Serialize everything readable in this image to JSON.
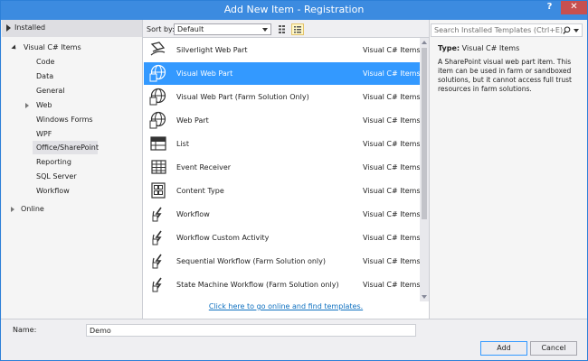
{
  "window": {
    "title": "Add New Item - Registration",
    "help_label": "?",
    "close_label": "✕"
  },
  "tree": {
    "header": "Installed",
    "root": "Visual C# Items",
    "children": [
      "Code",
      "Data",
      "General",
      "Web",
      "Windows Forms",
      "WPF",
      "Office/SharePoint",
      "Reporting",
      "SQL Server",
      "Workflow"
    ],
    "selected": "Office/SharePoint",
    "online": "Online"
  },
  "sortbar": {
    "label": "Sort by:",
    "value": "Default"
  },
  "templates": [
    {
      "name": "Silverlight Web Part",
      "category": "Visual C# Items",
      "icon": "silverlight-icon"
    },
    {
      "name": "Visual Web Part",
      "category": "Visual C# Items",
      "icon": "globe-page-icon",
      "selected": true
    },
    {
      "name": "Visual Web Part (Farm Solution Only)",
      "category": "Visual C# Items",
      "icon": "globe-page-icon"
    },
    {
      "name": "Web Part",
      "category": "Visual C# Items",
      "icon": "globe-page-icon"
    },
    {
      "name": "List",
      "category": "Visual C# Items",
      "icon": "list-icon"
    },
    {
      "name": "Event Receiver",
      "category": "Visual C# Items",
      "icon": "event-receiver-icon"
    },
    {
      "name": "Content Type",
      "category": "Visual C# Items",
      "icon": "content-type-icon"
    },
    {
      "name": "Workflow",
      "category": "Visual C# Items",
      "icon": "workflow-icon"
    },
    {
      "name": "Workflow Custom Activity",
      "category": "Visual C# Items",
      "icon": "workflow-icon"
    },
    {
      "name": "Sequential Workflow (Farm Solution only)",
      "category": "Visual C# Items",
      "icon": "workflow-icon"
    },
    {
      "name": "State Machine Workflow (Farm Solution only)",
      "category": "Visual C# Items",
      "icon": "workflow-icon"
    }
  ],
  "online_link": "Click here to go online and find templates.",
  "search": {
    "placeholder": "Search Installed Templates (Ctrl+E)"
  },
  "details": {
    "type_label": "Type:",
    "type_value": "Visual C# Items",
    "description": "A SharePoint visual web part item. This item can be used in farm or sandboxed solutions, but it cannot access full trust resources in farm solutions."
  },
  "footer": {
    "name_label": "Name:",
    "name_value": "Demo",
    "add_label": "Add",
    "cancel_label": "Cancel"
  },
  "colors": {
    "title_bar": "#3c8be0",
    "close": "#c75050",
    "selection": "#3399ff",
    "link": "#0e70c0"
  }
}
